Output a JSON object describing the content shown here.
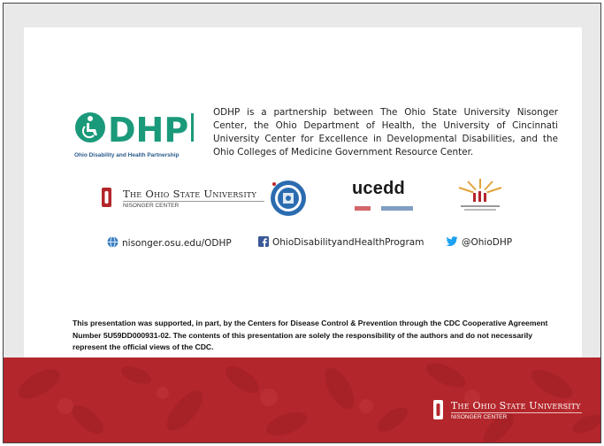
{
  "odhp": {
    "logo_text": "ODHP",
    "tagline": "Ohio Disability and Health Partnership",
    "description": "ODHP is a partnership between The Ohio State University Nisonger Center, the Ohio Department of Health, the University of Cincinnati University Center for Excellence in Developmental Disabilities, and the Ohio Colleges of Medicine Government Resource Center."
  },
  "partners": {
    "osu_name": "The Ohio State University",
    "osu_sub": "NISONGER CENTER",
    "ucedd": "ucedd"
  },
  "contacts": {
    "website": "nisonger.osu.edu/ODHP",
    "facebook": "OhioDisabilityandHealthProgram",
    "twitter": "@OhioDHP"
  },
  "disclaimer": "This presentation was supported, in part, by the Centers for Disease Control & Prevention through the CDC Cooperative Agreement Number 5U59DD000931-02. The contents of this presentation are solely the responsibility of the authors and do not necessarily represent the official views of the CDC.",
  "footer": {
    "osu_name": "The Ohio State University",
    "osu_sub": "NISONGER CENTER"
  },
  "colors": {
    "odhp_green": "#1a9a7a",
    "osu_scarlet": "#b3262b"
  }
}
